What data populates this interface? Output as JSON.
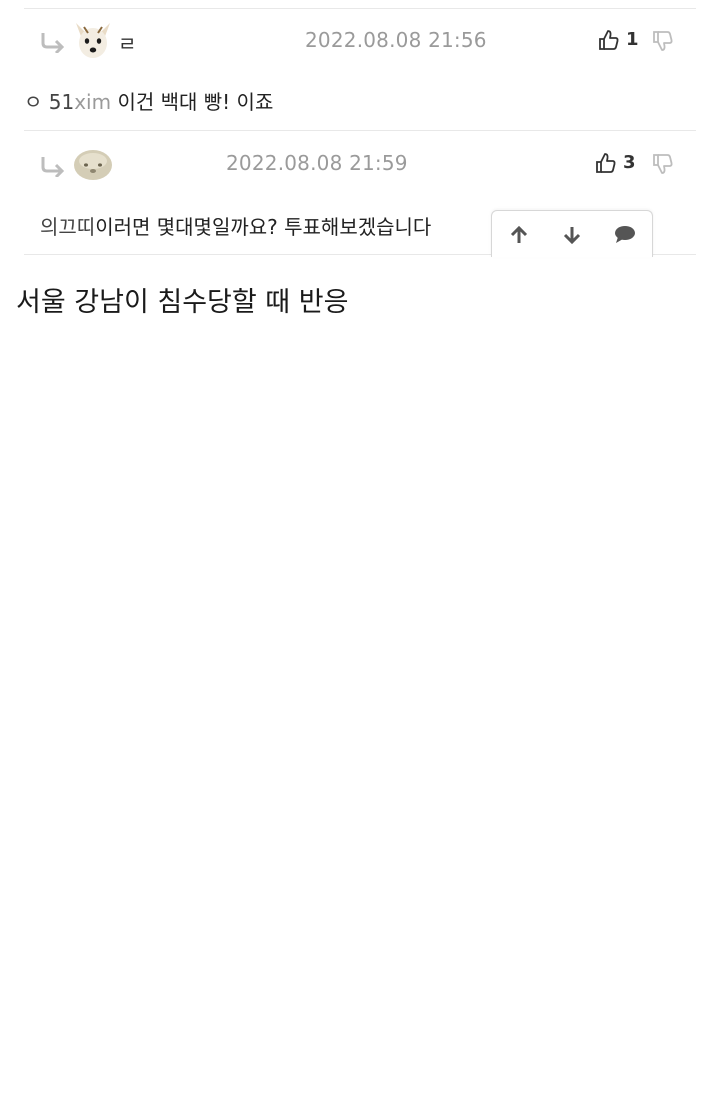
{
  "comments": [
    {
      "nickname_fragment": "ㄹ",
      "timestamp": "2022.08.08 21:56",
      "like_count": "1",
      "mention_prefix": "ㅇ 51",
      "mention_name": "xim",
      "text": " 이건 백대 빵! 이죠"
    },
    {
      "nickname_fragment": "",
      "timestamp": "2022.08.08 21:59",
      "like_count": "3",
      "mention_prefix": "의끄띠",
      "mention_name": "",
      "text": "이러면 몇대몇일까요? 투표해보겠습니다"
    }
  ],
  "toolbar": {
    "up_icon": "arrow-up-icon",
    "down_icon": "arrow-down-icon",
    "comment_icon": "speech-bubble-icon"
  },
  "post": {
    "title": "서울 강남이 침수당할 때 반응"
  },
  "colors": {
    "timestamp": "#9a9a9a",
    "divider": "#e8e8e8",
    "text": "#222222"
  }
}
